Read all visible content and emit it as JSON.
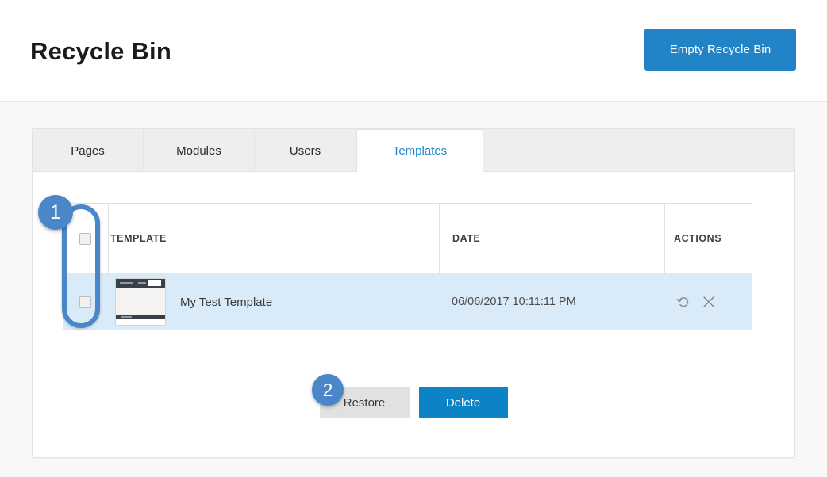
{
  "header": {
    "title": "Recycle Bin",
    "empty_button": "Empty Recycle Bin"
  },
  "tabs": [
    {
      "label": "Pages",
      "active": false
    },
    {
      "label": "Modules",
      "active": false
    },
    {
      "label": "Users",
      "active": false
    },
    {
      "label": "Templates",
      "active": true
    }
  ],
  "table": {
    "columns": [
      "",
      "TEMPLATE",
      "DATE",
      "ACTIONS"
    ],
    "rows": [
      {
        "selected": false,
        "name": "My Test Template",
        "date": "06/06/2017 10:11:11 PM",
        "actions": [
          "restore-icon",
          "delete-icon"
        ]
      }
    ]
  },
  "footer": {
    "restore_label": "Restore",
    "delete_label": "Delete"
  },
  "annotations": [
    {
      "number": "1",
      "target": "row-select-checkbox-column"
    },
    {
      "number": "2",
      "target": "restore-button"
    }
  ],
  "colors": {
    "accent_blue": "#2184c6",
    "delete_blue": "#0d82c4",
    "tab_active_text": "#1b87c9",
    "row_highlight": "#d9ebf9",
    "annotation_blue": "#4a86c8",
    "restore_gray": "#e1e1e1"
  }
}
